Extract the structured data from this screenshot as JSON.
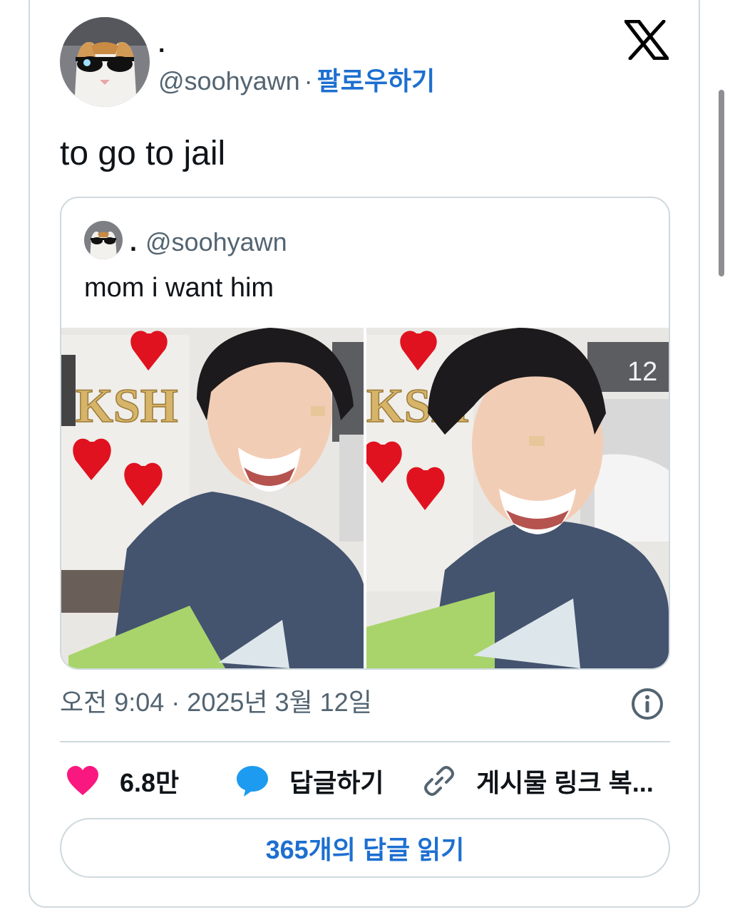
{
  "author": {
    "display_name": ".",
    "handle": "@soohyawn",
    "separator": "·",
    "follow_label": "팔로우하기"
  },
  "tweet": {
    "text": "to go to jail",
    "timestamp": "오전 9:04 · 2025년 3월 12일"
  },
  "quoted_tweet": {
    "display_name": ".",
    "handle": "@soohyawn",
    "text": "mom i want him",
    "photo_sign_text": "KSH",
    "photo_building_number": "12"
  },
  "actions": {
    "like_count": "6.8만",
    "reply_label": "답글하기",
    "copy_link_label": "게시물 링크 복..."
  },
  "read_replies_label": "365개의 답글 읽기",
  "colors": {
    "accent_blue": "#1d6fd0",
    "like_pink": "#f91880",
    "reply_blue": "#1d9bf0",
    "secondary_text": "#536471",
    "border": "#cfd9de"
  },
  "icons": {
    "logo": "x-logo-icon",
    "like": "heart-icon",
    "reply": "speech-bubble-icon",
    "copy": "link-icon",
    "info": "info-icon"
  }
}
